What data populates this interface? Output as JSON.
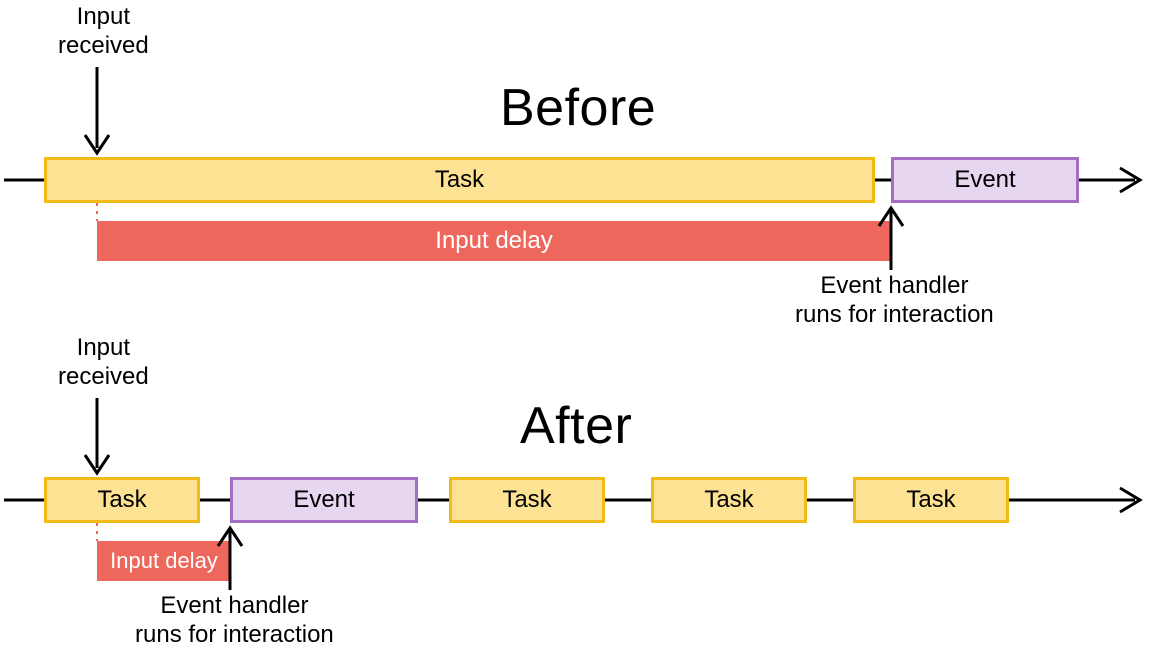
{
  "before": {
    "heading": "Before",
    "input_received": "Input\nreceived",
    "task_label": "Task",
    "event_label": "Event",
    "delay_label": "Input delay",
    "handler_label": "Event handler\nruns for interaction"
  },
  "after": {
    "heading": "After",
    "input_received": "Input\nreceived",
    "task_labels": [
      "Task",
      "Task",
      "Task",
      "Task"
    ],
    "event_label": "Event",
    "delay_label": "Input delay",
    "handler_label": "Event handler\nruns for interaction"
  },
  "colors": {
    "task_fill": "#fde293",
    "task_border": "#f2bb15",
    "event_fill": "#e7d6ef",
    "event_border": "#a36dc1",
    "delay_fill": "#ee675c"
  }
}
